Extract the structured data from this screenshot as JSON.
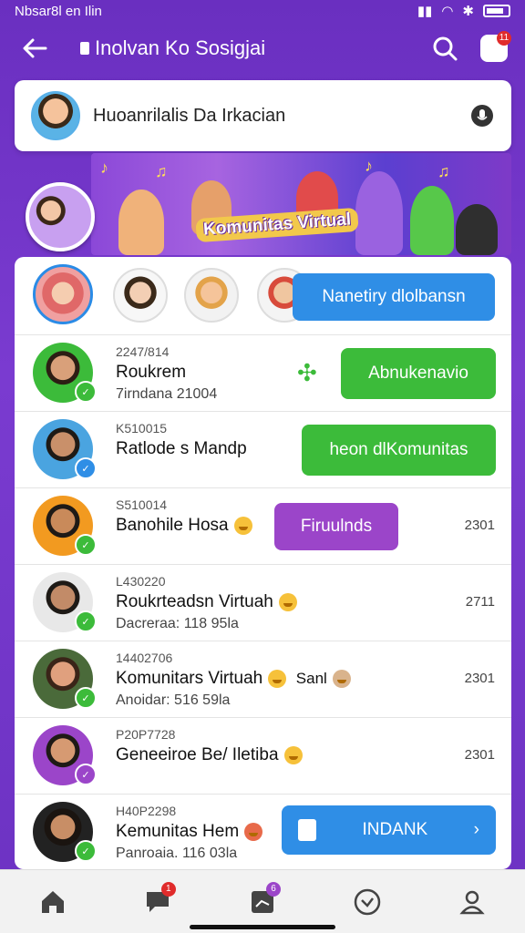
{
  "status_bar": {
    "left": "Nbsar8l en Ilin"
  },
  "header": {
    "title": "Inolvan Ko Sosigjai",
    "notif_count": "11"
  },
  "search": {
    "text": "Huoanrilalis Da Irkacian"
  },
  "banner": {
    "title": "Komunitas Virtual"
  },
  "stories": {
    "cta": "Nanetiry dlolbansn"
  },
  "rows": [
    {
      "meta": "2247/814",
      "name": "Roukrem",
      "sub": "7irndana 21004",
      "time": "",
      "bubble": "Abnukenavio",
      "bubble_color": "green"
    },
    {
      "meta": "K510015",
      "name": "Ratlode s Mandp",
      "sub": "",
      "time": "",
      "bubble": "heon dlKomunitas",
      "bubble_color": "green"
    },
    {
      "meta": "S510014",
      "name": "Banohile Hosa",
      "sub": "",
      "time": "2301",
      "bubble": "Firuulnds",
      "bubble_color": "purple"
    },
    {
      "meta": "L430220",
      "name": "Roukrteadsn Virtuah",
      "sub": "Dacreraa: 118 95la",
      "time": "2711",
      "bubble": ""
    },
    {
      "meta": "14402706",
      "name": "Komunitars Virtuah",
      "name_extra": "Sanl",
      "sub": "Anoidar: 516 59la",
      "time": "2301",
      "bubble": ""
    },
    {
      "meta": "P20P7728",
      "name": "Geneeiroe Be/ Iletiba",
      "sub": "",
      "time": "2301",
      "bubble": ""
    },
    {
      "meta": "H40P2298",
      "name": "Kemunitas Hem",
      "sub": "Panroaia. 116 03la",
      "time": "",
      "bubble": "INDANK",
      "bubble_color": "blue"
    }
  ],
  "colors": {
    "brand": "#6a2fc0",
    "accent_blue": "#2f8ee6",
    "accent_green": "#3cbb3a",
    "accent_purple": "#9b45c9"
  },
  "nav": {
    "chat_badge": "1",
    "feed_badge": "6"
  }
}
